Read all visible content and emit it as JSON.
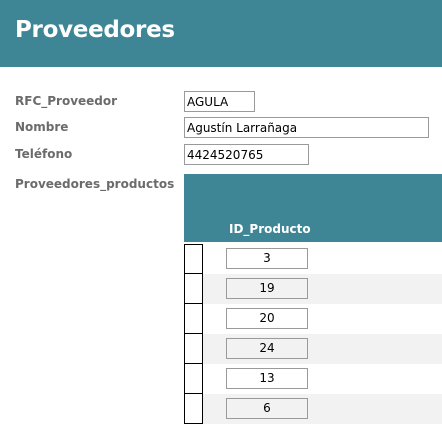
{
  "form": {
    "title": "Proveedores"
  },
  "fields": {
    "rfc": {
      "label": "RFC_Proveedor",
      "value": "AGULA"
    },
    "nombre": {
      "label": "Nombre",
      "value": "Agustín Larrañaga"
    },
    "telefono": {
      "label": "Teléfono",
      "value": "4424520765"
    }
  },
  "subform": {
    "label": "Proveedores_productos",
    "column_header": "ID_Producto",
    "rows": [
      "3",
      "19",
      "20",
      "24",
      "13",
      "6"
    ]
  },
  "colors": {
    "header": "#3e8696",
    "label_text": "#6b6b6b",
    "alt_row": "#f2f2f2"
  }
}
